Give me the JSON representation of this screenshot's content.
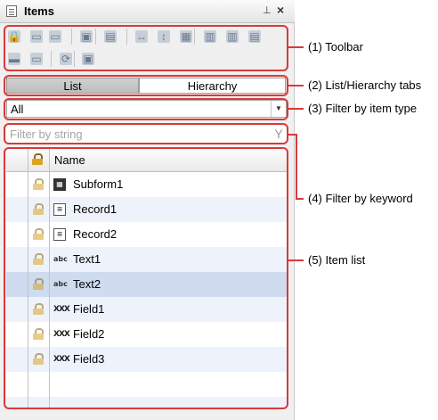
{
  "window": {
    "title": "Items",
    "pin_glyph": "⊥",
    "close_glyph": "×"
  },
  "toolbar": {
    "buttons": [
      {
        "name": "lock-all-icon",
        "glyph": "🔒"
      },
      {
        "name": "move-to-back-icon",
        "glyph": "▭"
      },
      {
        "name": "move-to-front-icon",
        "glyph": "▭"
      },
      {
        "name": "layer-icon",
        "glyph": "▣"
      },
      {
        "name": "group-icon",
        "glyph": "▤"
      },
      {
        "name": "same-width-icon",
        "glyph": "↔"
      },
      {
        "name": "same-height-icon",
        "glyph": "↕"
      },
      {
        "name": "same-size-icon",
        "glyph": "▦"
      },
      {
        "name": "align-icon",
        "glyph": "▥"
      },
      {
        "name": "distribute-icon",
        "glyph": "▥"
      },
      {
        "name": "order-icon",
        "glyph": "▤"
      },
      {
        "name": "collapse-icon",
        "glyph": "▬"
      },
      {
        "name": "expand-icon",
        "glyph": "▭"
      },
      {
        "name": "refresh-icon",
        "glyph": "⟳"
      },
      {
        "name": "properties-icon",
        "glyph": "▣"
      }
    ]
  },
  "tabs": {
    "list": "List",
    "hierarchy": "Hierarchy"
  },
  "type_filter": {
    "value": "All",
    "arrow": "▼"
  },
  "string_filter": {
    "placeholder": "Filter by string",
    "icon": "Y"
  },
  "item_list": {
    "header_name": "Name",
    "rows": [
      {
        "label": "Subform1",
        "icon": "subform",
        "glyph": "▦"
      },
      {
        "label": "Record1",
        "icon": "record",
        "glyph": "≡"
      },
      {
        "label": "Record2",
        "icon": "record",
        "glyph": "≡"
      },
      {
        "label": "Text1",
        "icon": "text",
        "glyph": "abc"
      },
      {
        "label": "Text2",
        "icon": "text",
        "glyph": "abc"
      },
      {
        "label": "Field1",
        "icon": "field",
        "glyph": "XXX"
      },
      {
        "label": "Field2",
        "icon": "field",
        "glyph": "XXX"
      },
      {
        "label": "Field3",
        "icon": "field",
        "glyph": "XXX"
      }
    ],
    "selected_index": 4
  },
  "callouts": {
    "toolbar": "(1) Toolbar",
    "tabs": "(2) List/Hierarchy tabs",
    "type_filter": "(3) Filter by item type",
    "keyword_filter": "(4) Filter by keyword",
    "item_list": "(5) Item list"
  },
  "colors": {
    "callout": "#d83a3a",
    "selected_row": "#cfdbee",
    "alt_row": "#eef3fb"
  }
}
